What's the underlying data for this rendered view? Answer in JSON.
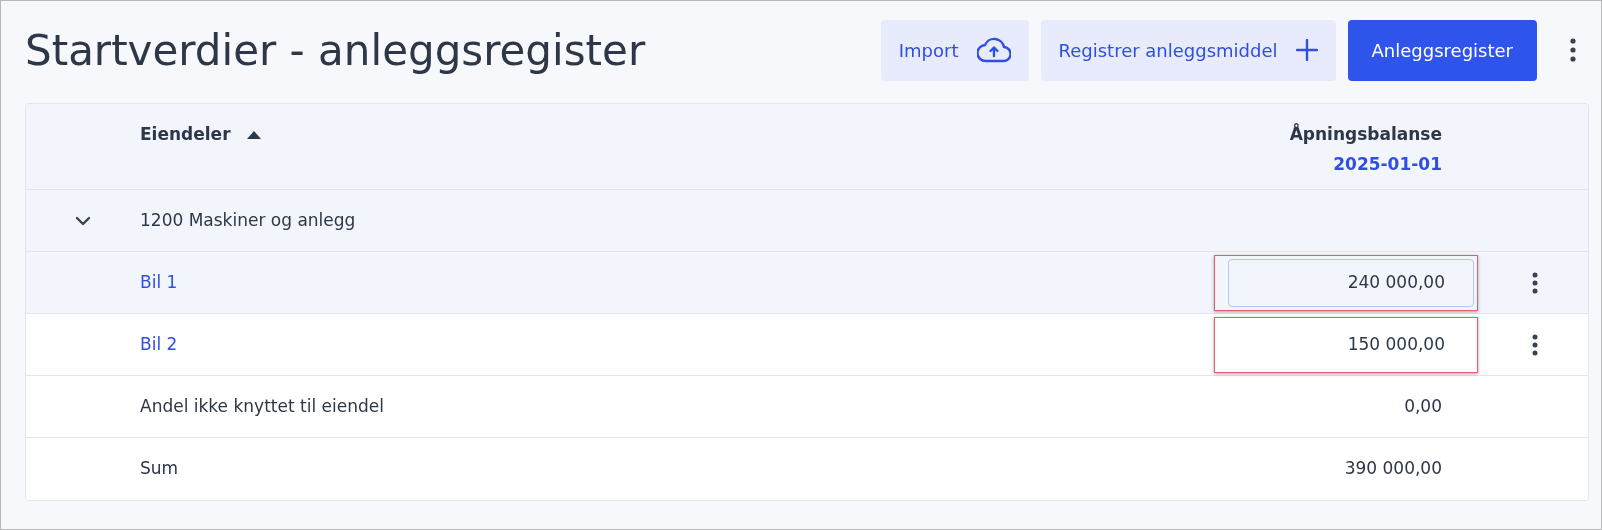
{
  "page": {
    "title": "Startverdier - anleggsregister"
  },
  "toolbar": {
    "buttons": [
      {
        "kind": "import",
        "label": "Import"
      },
      {
        "kind": "add",
        "label": "Registrer anleggsmiddel"
      },
      {
        "kind": "primary",
        "label": "Anleggsregister"
      }
    ]
  },
  "table": {
    "columns": [
      {
        "label": "Eiendeler",
        "sort_ascending": true
      },
      {
        "label": "Åpningsbalanse",
        "sublabel": "2025-01-01"
      }
    ],
    "rows": [
      {
        "kind": "group",
        "label": "1200 Maskiner og anlegg",
        "expanded": true
      },
      {
        "kind": "asset",
        "label": "Bil 1",
        "value": "240 000,00",
        "selected": true,
        "focused": true
      },
      {
        "kind": "asset",
        "label": "Bil 2",
        "value": "150 000,00",
        "selected": false,
        "focused": false
      },
      {
        "kind": "plain",
        "label": "Andel ikke knyttet til eiendel",
        "value": "0,00"
      },
      {
        "kind": "plain",
        "label": "Sum",
        "value": "390 000,00"
      }
    ]
  }
}
